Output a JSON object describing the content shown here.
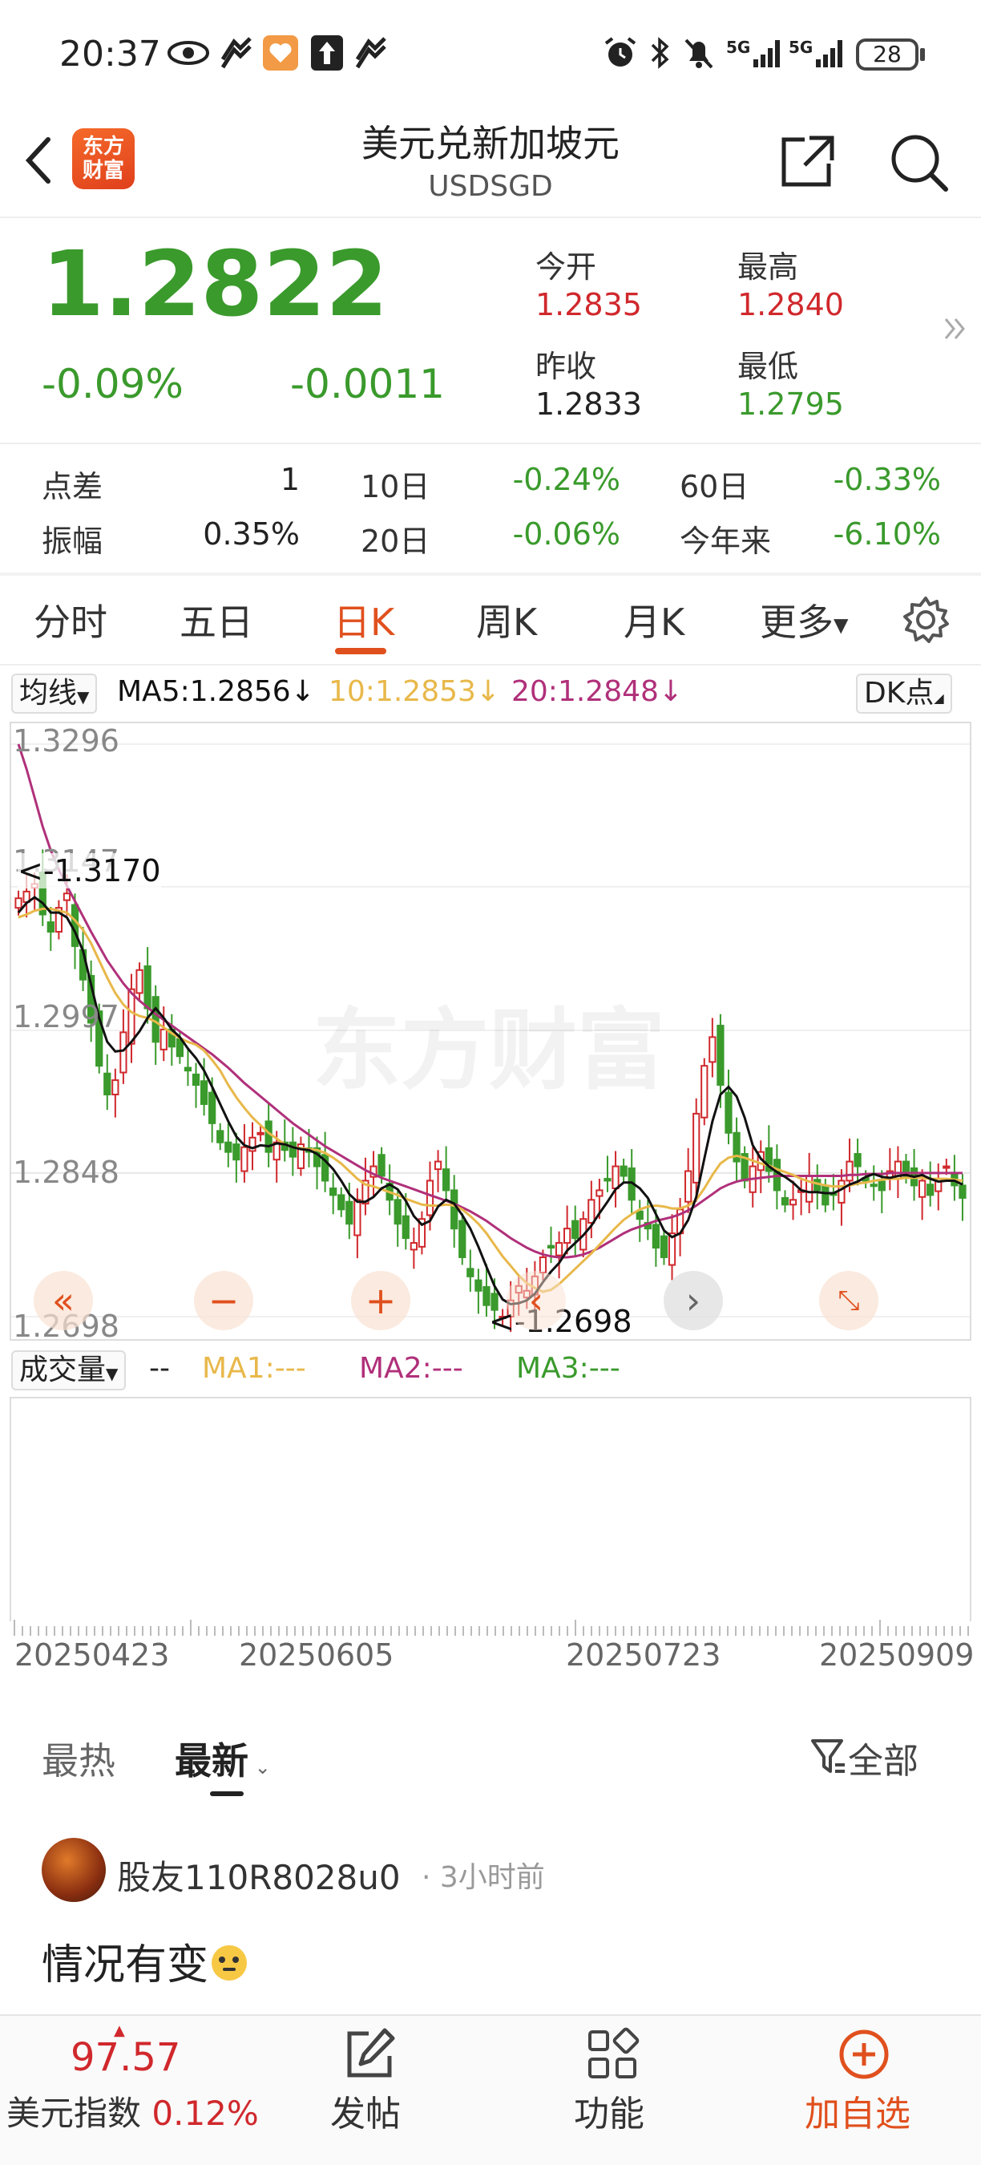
{
  "status_bar": {
    "time": "20:37",
    "battery": "28",
    "network": "5G"
  },
  "header": {
    "title": "美元兑新加坡元",
    "subtitle": "USDSGD",
    "logo_text_1": "东方",
    "logo_text_2": "财富"
  },
  "quote": {
    "price": "1.2822",
    "change_pct": "-0.09%",
    "change_abs": "-0.0011",
    "open_label": "今开",
    "open": "1.2835",
    "high_label": "最高",
    "high": "1.2840",
    "prev_close_label": "昨收",
    "prev_close": "1.2833",
    "low_label": "最低",
    "low": "1.2795"
  },
  "stats": {
    "spread_label": "点差",
    "spread": "1",
    "d10_label": "10日",
    "d10": "-0.24%",
    "d60_label": "60日",
    "d60": "-0.33%",
    "amplitude_label": "振幅",
    "amplitude": "0.35%",
    "d20_label": "20日",
    "d20": "-0.06%",
    "ytd_label": "今年来",
    "ytd": "-6.10%"
  },
  "tabs": [
    "分时",
    "五日",
    "日K",
    "周K",
    "月K",
    "更多"
  ],
  "ma_bar": {
    "selector": "均线",
    "ma5": "MA5:1.2856↓",
    "ma10": "10:1.2853↓",
    "ma20": "20:1.2848↓",
    "dk": "DK点"
  },
  "chart_data": {
    "type": "candlestick",
    "y_ticks": [
      "1.3296",
      "1.3147",
      "1.2997",
      "1.2848",
      "1.2698"
    ],
    "ylim": [
      1.2698,
      1.3296
    ],
    "max_marker": "<-1.3170",
    "min_marker": "<-1.2698",
    "x_ticks": [
      "20250423",
      "20250605",
      "20250723",
      "20250909"
    ],
    "watermark": "东方财富",
    "close_series": [
      1.3135,
      1.3142,
      1.315,
      1.3118,
      1.31,
      1.3125,
      1.314,
      1.3085,
      1.305,
      1.3005,
      1.296,
      1.293,
      1.2945,
      1.2995,
      1.304,
      1.306,
      1.302,
      1.2985,
      1.2998,
      1.298,
      1.297,
      1.2955,
      1.294,
      1.292,
      1.29,
      1.288,
      1.287,
      1.2862,
      1.2875,
      1.2885,
      1.289,
      1.287,
      1.288,
      1.2872,
      1.2865,
      1.2878,
      1.287,
      1.2855,
      1.284,
      1.2825,
      1.281,
      1.2795,
      1.282,
      1.284,
      1.2855,
      1.2845,
      1.282,
      1.2795,
      1.278,
      1.2775,
      1.28,
      1.284,
      1.286,
      1.283,
      1.279,
      1.276,
      1.274,
      1.2725,
      1.271,
      1.2705,
      1.2698,
      1.2715,
      1.273,
      1.2725,
      1.274,
      1.276,
      1.277,
      1.2775,
      1.279,
      1.278,
      1.28,
      1.282,
      1.283,
      1.284,
      1.2855,
      1.2845,
      1.282,
      1.28,
      1.279,
      1.277,
      1.276,
      1.2785,
      1.281,
      1.285,
      1.291,
      1.296,
      1.299,
      1.294,
      1.289,
      1.286,
      1.284,
      1.2855,
      1.287,
      1.285,
      1.283,
      1.2815,
      1.282,
      1.283,
      1.2845,
      1.283,
      1.2815,
      1.2825,
      1.284,
      1.286,
      1.2855,
      1.284,
      1.2835,
      1.283,
      1.285,
      1.286,
      1.2845,
      1.2835,
      1.284,
      1.2825,
      1.2842,
      1.2855,
      1.2835,
      1.2822
    ],
    "ma5": [
      1.312,
      1.313,
      1.3136,
      1.313,
      1.312,
      1.312,
      1.3115,
      1.31,
      1.308,
      1.3045,
      1.301,
      1.2985,
      1.2975,
      1.2976,
      1.2985,
      1.2996,
      1.301,
      1.302,
      1.301,
      1.2998,
      1.299,
      1.2978,
      1.2968,
      1.2955,
      1.2938,
      1.292,
      1.2902,
      1.2886,
      1.2877,
      1.2874,
      1.2877,
      1.2876,
      1.2879,
      1.2878,
      1.2875,
      1.2873,
      1.2872,
      1.2868,
      1.2861,
      1.2852,
      1.284,
      1.2826,
      1.2818,
      1.2818,
      1.2823,
      1.2832,
      1.2836,
      1.2831,
      1.2819,
      1.2803,
      1.2794,
      1.2798,
      1.2813,
      1.282,
      1.2816,
      1.2804,
      1.279,
      1.2771,
      1.275,
      1.273,
      1.2716,
      1.2711,
      1.2712,
      1.2715,
      1.2722,
      1.2734,
      1.2745,
      1.2754,
      1.2767,
      1.2775,
      1.2783,
      1.2793,
      1.2806,
      1.2818,
      1.2831,
      1.2838,
      1.2838,
      1.2832,
      1.2822,
      1.2805,
      1.2788,
      1.2781,
      1.2785,
      1.2799,
      1.2823,
      1.2863,
      1.2902,
      1.293,
      1.2938,
      1.2928,
      1.2906,
      1.2877,
      1.2863,
      1.2855,
      1.2849,
      1.2844,
      1.2838,
      1.283,
      1.2828,
      1.2828,
      1.2827,
      1.2827,
      1.2831,
      1.2836,
      1.2839,
      1.2844,
      1.2847,
      1.2844,
      1.2843,
      1.2845,
      1.2846,
      1.2844,
      1.2846,
      1.2842,
      1.2839,
      1.284,
      1.284,
      1.2836
    ],
    "ma10": [
      1.3115,
      1.3118,
      1.3122,
      1.3124,
      1.3124,
      1.3122,
      1.312,
      1.3112,
      1.3102,
      1.3088,
      1.307,
      1.3052,
      1.3036,
      1.3024,
      1.3016,
      1.3012,
      1.301,
      1.3006,
      1.3,
      1.2994,
      1.2989,
      1.2985,
      1.2982,
      1.2976,
      1.2966,
      1.2955,
      1.294,
      1.2927,
      1.2916,
      1.2906,
      1.2898,
      1.289,
      1.2884,
      1.2878,
      1.2875,
      1.2874,
      1.2873,
      1.2872,
      1.2869,
      1.2864,
      1.2858,
      1.285,
      1.2842,
      1.2836,
      1.2834,
      1.2831,
      1.2828,
      1.2825,
      1.2821,
      1.2818,
      1.2815,
      1.2814,
      1.2814,
      1.2815,
      1.2814,
      1.281,
      1.2803,
      1.2795,
      1.2785,
      1.2773,
      1.2761,
      1.2751,
      1.2741,
      1.2733,
      1.2728,
      1.2724,
      1.2726,
      1.2732,
      1.274,
      1.2748,
      1.2756,
      1.2764,
      1.2773,
      1.2782,
      1.2791,
      1.2799,
      1.2805,
      1.281,
      1.2813,
      1.2814,
      1.2813,
      1.2811,
      1.2811,
      1.2814,
      1.282,
      1.2832,
      1.2846,
      1.2858,
      1.2864,
      1.2866,
      1.2864,
      1.2861,
      1.2858,
      1.2856,
      1.2852,
      1.2849,
      1.2846,
      1.2842,
      1.2839,
      1.2837,
      1.2835,
      1.2834,
      1.2834,
      1.2835,
      1.2837,
      1.2838,
      1.284,
      1.2841,
      1.2842,
      1.2842,
      1.2843,
      1.2843,
      1.2843,
      1.2842,
      1.2842,
      1.2842,
      1.2841,
      1.284
    ],
    "ma20": [
      1.3296,
      1.327,
      1.324,
      1.321,
      1.3185,
      1.3165,
      1.3148,
      1.3132,
      1.3116,
      1.31,
      1.3085,
      1.307,
      1.3058,
      1.3046,
      1.3036,
      1.3028,
      1.3021,
      1.3014,
      1.3008,
      1.3002,
      1.2996,
      1.299,
      1.2984,
      1.2978,
      1.2972,
      1.2965,
      1.2958,
      1.295,
      1.2942,
      1.2935,
      1.2928,
      1.2921,
      1.2914,
      1.2907,
      1.29,
      1.2894,
      1.2888,
      1.2882,
      1.2876,
      1.2871,
      1.2866,
      1.2861,
      1.2856,
      1.2851,
      1.2847,
      1.2843,
      1.284,
      1.2837,
      1.2834,
      1.2831,
      1.2828,
      1.2825,
      1.2822,
      1.2819,
      1.2816,
      1.2812,
      1.2808,
      1.2803,
      1.2798,
      1.2792,
      1.2786,
      1.278,
      1.2775,
      1.277,
      1.2766,
      1.2763,
      1.2761,
      1.276,
      1.276,
      1.2761,
      1.2763,
      1.2766,
      1.277,
      1.2775,
      1.278,
      1.2785,
      1.2789,
      1.2792,
      1.2795,
      1.2798,
      1.28,
      1.2802,
      1.2805,
      1.2809,
      1.2814,
      1.282,
      1.2826,
      1.2832,
      1.2836,
      1.2839,
      1.2841,
      1.2842,
      1.2843,
      1.2844,
      1.2845,
      1.2845,
      1.2845,
      1.2845,
      1.2845,
      1.2845,
      1.2845,
      1.2845,
      1.2845,
      1.2846,
      1.2846,
      1.2847,
      1.2847,
      1.2847,
      1.2848,
      1.2848,
      1.2848,
      1.2848,
      1.2848,
      1.2848,
      1.2848,
      1.2848,
      1.2848,
      1.2848
    ]
  },
  "volume_bar": {
    "selector": "成交量",
    "dash": "--",
    "ma1": "MA1:---",
    "ma2": "MA2:---",
    "ma3": "MA3:---"
  },
  "comments": {
    "tab_hot": "最热",
    "tab_new": "最新",
    "filter": "全部",
    "user": "股友110R8028u0",
    "time": "· 3小时前",
    "text": "情况有变"
  },
  "bottom_bar": {
    "index_value": "97.57",
    "index_name": "美元指数",
    "index_change": "0.12%",
    "post": "发帖",
    "functions": "功能",
    "add_watch": "加自选"
  },
  "colors": {
    "up": "#d0282c",
    "down": "#3a9a2c",
    "accent": "#e0501e",
    "ma5": "#111111",
    "ma10": "#e8b84a",
    "ma20": "#b0307a"
  }
}
